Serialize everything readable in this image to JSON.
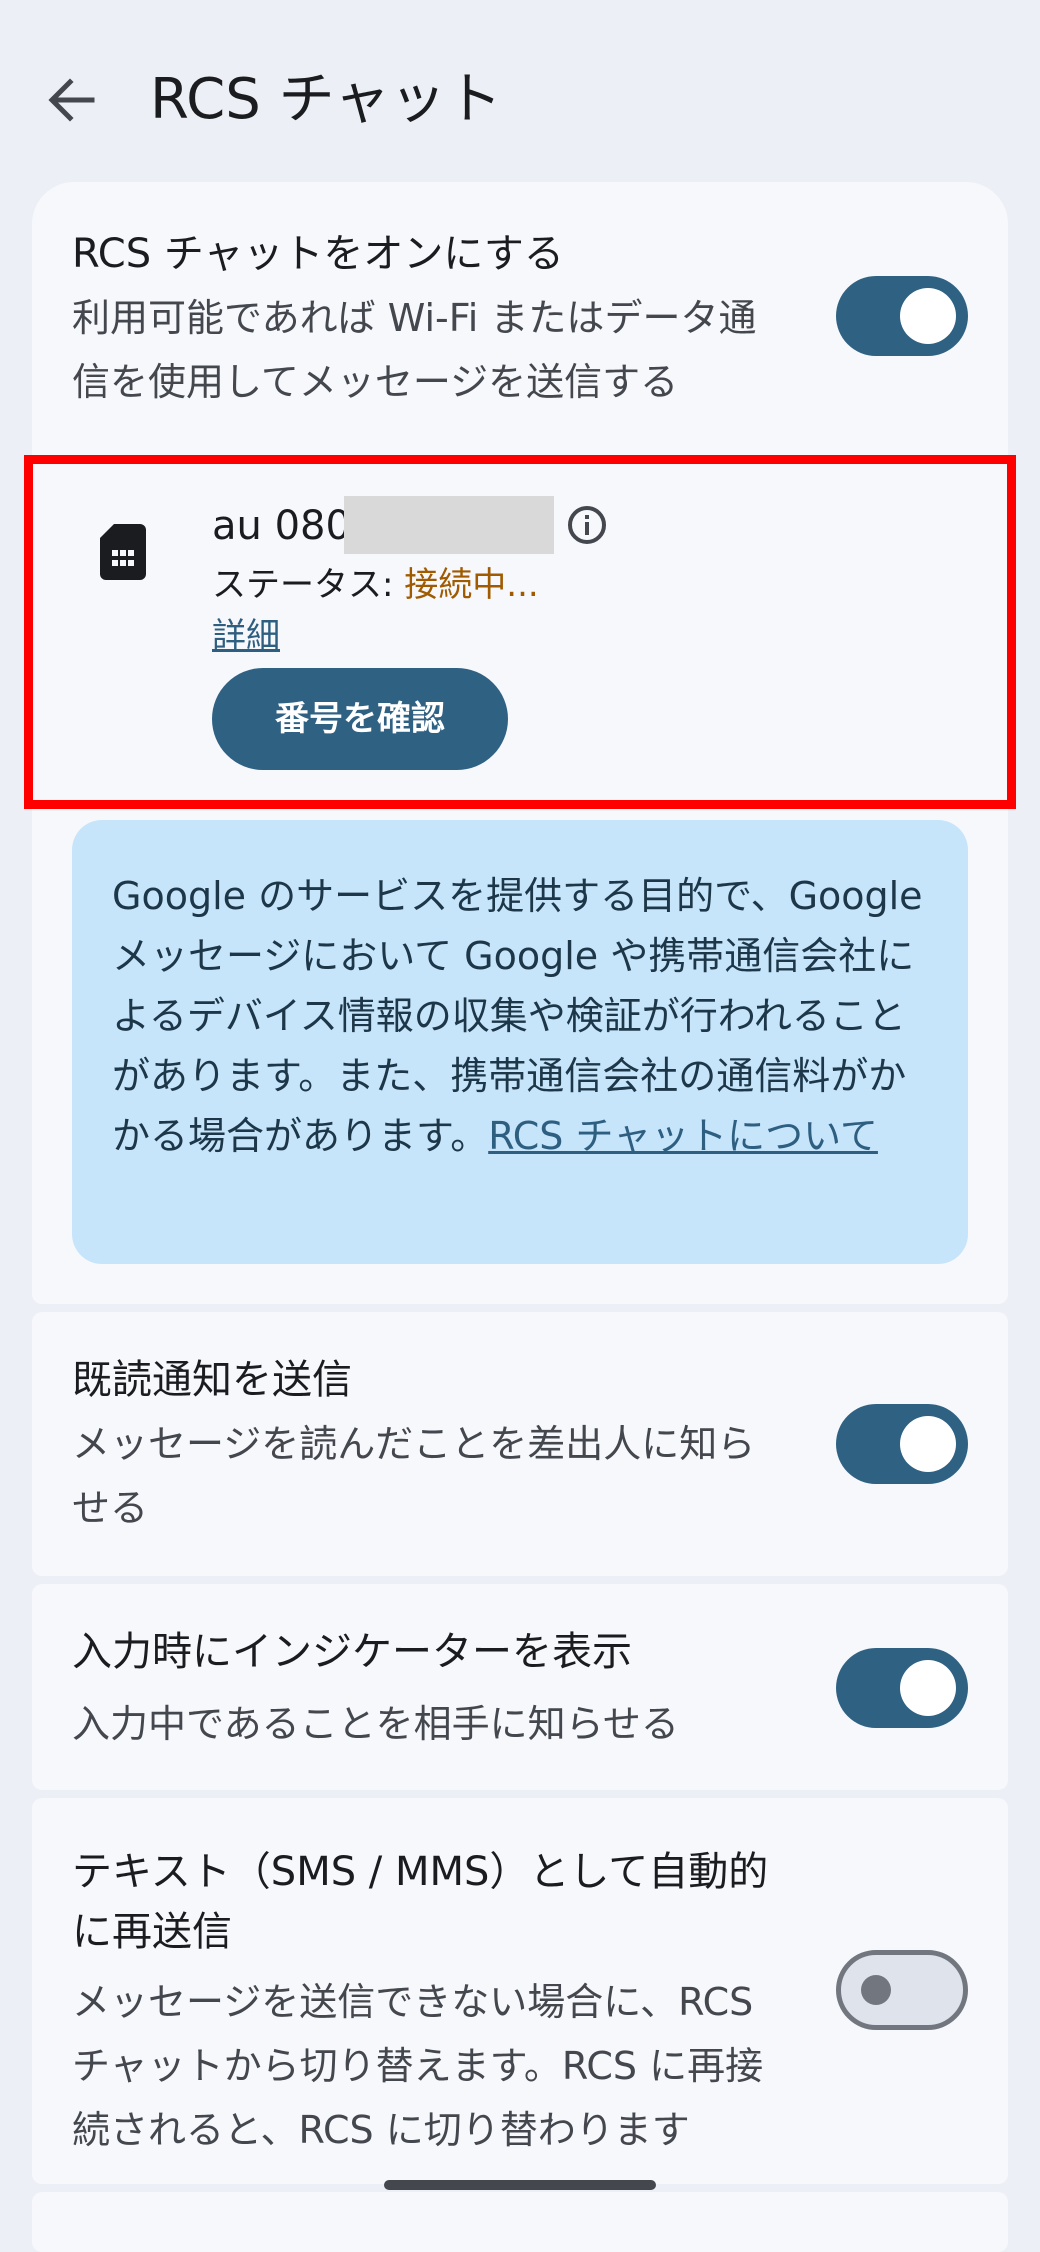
{
  "header": {
    "title": "RCS チャット",
    "back_icon": "arrow-back-icon"
  },
  "rcs_toggle": {
    "title": "RCS チャットをオンにする",
    "subtitle": "利用可能であれば Wi-Fi またはデータ通信を使用してメッセージを送信する",
    "enabled": true
  },
  "sim": {
    "icon": "sim-card-icon",
    "carrier_number": "au 080",
    "number_redacted": true,
    "info_icon": "info-icon",
    "status_label": "ステータス: ",
    "status_value": "接続中...",
    "details_link": "詳細",
    "verify_button": "番号を確認"
  },
  "notice": {
    "text": "Google のサービスを提供する目的で、Google メッセージにおいて Google や携帯通信会社によるデバイス情報の収集や検証が行われることがあります。また、携帯通信会社の通信料がかかる場合があります。",
    "link": "RCS チャットについて"
  },
  "read_receipts": {
    "title": "既読通知を送信",
    "subtitle": "メッセージを読んだことを差出人に知らせる",
    "enabled": true
  },
  "typing_indicator": {
    "title": "入力時にインジケーターを表示",
    "subtitle": "入力中であることを相手に知らせる",
    "enabled": true
  },
  "auto_resend": {
    "title": "テキスト（SMS / MMS）として自動的に再送信",
    "subtitle": "メッセージを送信できない場合に、RCS チャットから切り替えます。RCS に再接続されると、RCS に切り替わります",
    "enabled": false
  },
  "colors": {
    "background": "#eceff5",
    "card": "#f6f8fc",
    "accent": "#2f6183",
    "status": "#a05a00",
    "notice_bg": "#c6e5fb",
    "highlight": "#ff0000"
  }
}
